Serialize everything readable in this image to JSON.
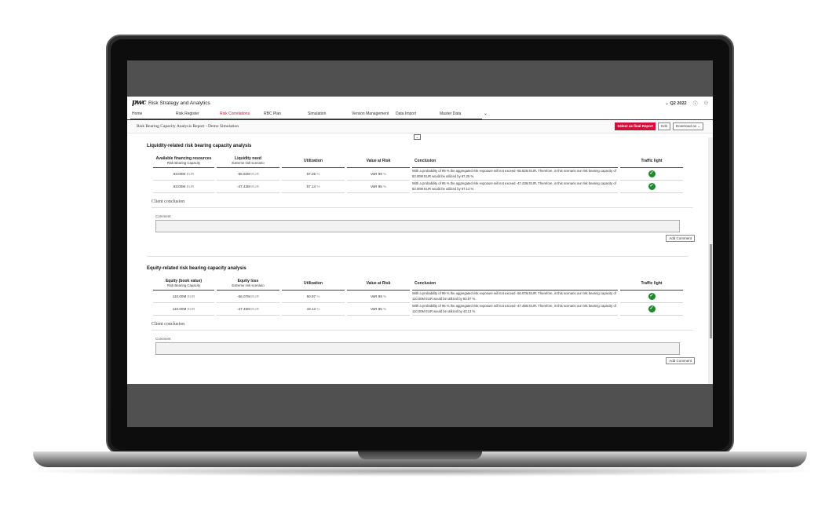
{
  "app": {
    "logo": "pwc",
    "title": "Risk Strategy and Analytics",
    "period": "Q2 2022",
    "help_icon": "help-circle-icon",
    "user_icon": "user-icon"
  },
  "nav": {
    "items": [
      {
        "label": "Home",
        "active": false
      },
      {
        "label": "Risk Register",
        "active": false
      },
      {
        "label": "Risk Correlations",
        "active": true
      },
      {
        "label": "RBC Plan",
        "active": false
      },
      {
        "label": "Simulation",
        "active": false
      },
      {
        "label": "Version Management",
        "active": false
      },
      {
        "label": "Data Import",
        "active": false
      },
      {
        "label": "Master Data",
        "active": false
      }
    ],
    "more_icon": "chevron-down-icon"
  },
  "subbar": {
    "report_title": "Risk Bearing Capacity Analysis Report - Demo Simulation",
    "select_final_label": "Select as final Report",
    "edit_label": "Edit",
    "download_label": "Download as"
  },
  "liquidity": {
    "title": "Liquidity-related risk bearing capacity analysis",
    "headers": {
      "col1": "Available financing resources",
      "col1_sub": "Risk Bearing Capacity",
      "col2": "Liquidity need",
      "col2_sub": "Extreme risk scenario",
      "col3": "Utilization",
      "col4": "Value at Risk",
      "col5": "Conclusion",
      "col6": "Traffic light"
    },
    "rows": [
      {
        "resources": "83.00M",
        "resources_unit": "EUR",
        "need": "-55.82M",
        "need_unit": "EUR",
        "utilization": "67.25",
        "util_unit": "%",
        "var": "VaR 99",
        "var_unit": "%",
        "conclusion": "With a probability of 99 % the aggregated risk exposure will not exceed -55.82M EUR. Therefore, in this scenario our risk bearing capacity of 83.00M EUR would be utilized by 67.25 %.",
        "light": "green"
      },
      {
        "resources": "83.00M",
        "resources_unit": "EUR",
        "need": "-47.43M",
        "need_unit": "EUR",
        "utilization": "57.14",
        "util_unit": "%",
        "var": "VaR 95",
        "var_unit": "%",
        "conclusion": "With a probability of 95 % the aggregated risk exposure will not exceed -47.43M EUR. Therefore, in this scenario our risk bearing capacity of 83.00M EUR would be utilized by 57.14 %.",
        "light": "green"
      }
    ],
    "client_conclusion": "Client conclusion",
    "comment_label": "Comment",
    "add_comment": "Add Comment"
  },
  "equity": {
    "title": "Equity-related risk bearing capacity analysis",
    "headers": {
      "col1": "Equity (book value)",
      "col1_sub": "Risk Bearing Capacity",
      "col2": "Equity loss",
      "col2_sub": "Extreme risk scenario",
      "col3": "Utilization",
      "col4": "Value at Risk",
      "col5": "Conclusion",
      "col6": "Traffic light"
    },
    "rows": [
      {
        "resources": "110.00M",
        "resources_unit": "EUR",
        "need": "-56.07M",
        "need_unit": "EUR",
        "utilization": "50.97",
        "util_unit": "%",
        "var": "VaR 99",
        "var_unit": "%",
        "conclusion": "With a probability of 99 % the aggregated risk exposure will not exceed -56.07M EUR. Therefore, in this scenario our risk bearing capacity of 110.00M EUR would be utilized by 50.97 %.",
        "light": "green"
      },
      {
        "resources": "110.00M",
        "resources_unit": "EUR",
        "need": "-47.45M",
        "need_unit": "EUR",
        "utilization": "43.13",
        "util_unit": "%",
        "var": "VaR 95",
        "var_unit": "%",
        "conclusion": "With a probability of 95 % the aggregated risk exposure will not exceed -47.45M EUR. Therefore, in this scenario our risk bearing capacity of 110.00M EUR would be utilized by 43.13 %.",
        "light": "green"
      }
    ],
    "client_conclusion": "Client conclusion",
    "comment_label": "Comment",
    "add_comment": "Add Comment"
  },
  "colors": {
    "accent": "#d0103a",
    "check": "#1b8a2e"
  }
}
